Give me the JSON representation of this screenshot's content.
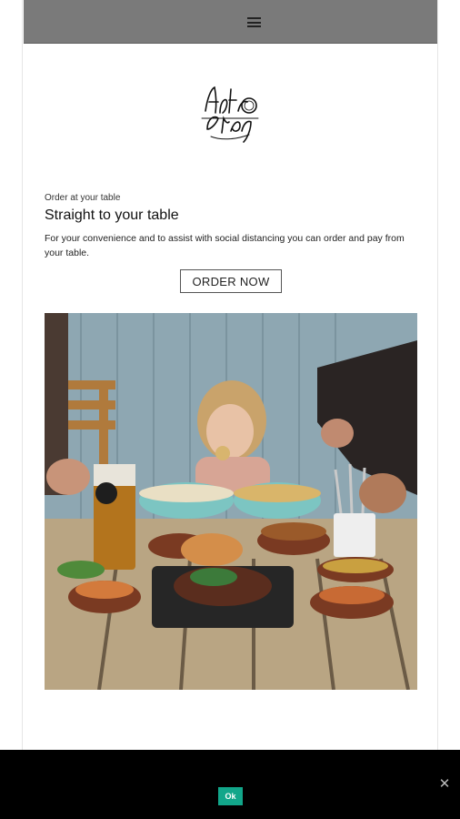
{
  "header": {
    "menu_icon": "hamburger-menu-icon"
  },
  "brand": {
    "logo": "brand-logo"
  },
  "content": {
    "eyebrow": "Order at your table",
    "title": "Straight to your table",
    "description": "For your convenience and to assist with social distancing you can order and pay from your table.",
    "order_button": "ORDER NOW"
  },
  "hero_image": {
    "subject": "food-table-photo"
  },
  "cookie_banner": {
    "ok_label": "Ok",
    "close_icon": "close-icon",
    "accent_color": "#12a68a"
  }
}
